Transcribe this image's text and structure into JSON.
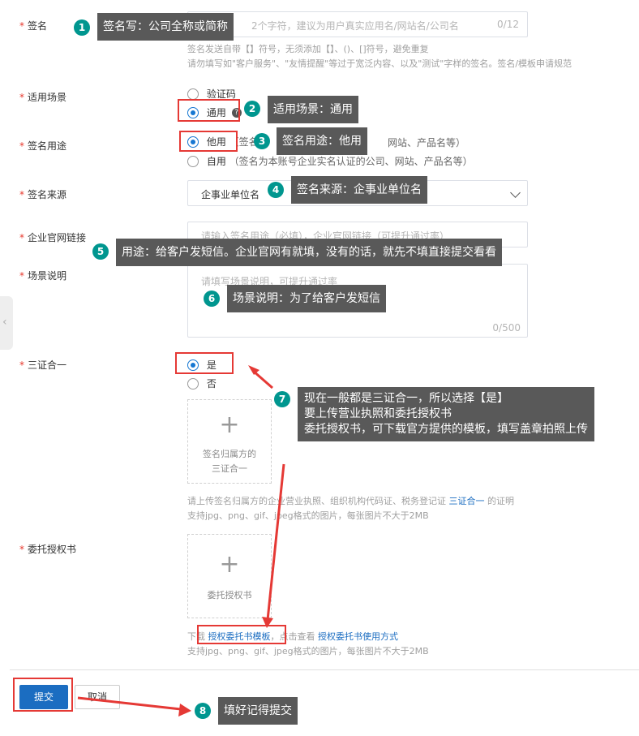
{
  "form": {
    "req": "*",
    "signature": {
      "label": "签名",
      "placeholder": "2个字符，建议为用户真实应用名/网站名/公司名",
      "counter": "0/12",
      "hint1": "签名发送自带【】符号，无须添加【】、()、[]符号，避免重复",
      "hint2": "请勿填写如\"客户服务\"、\"友情提醒\"等过于宽泛内容、以及\"测试\"字样的签名。签名/模板申请规范"
    },
    "scene": {
      "label": "适用场景",
      "opt1": "验证码",
      "opt2": "通用",
      "help": "?"
    },
    "usage": {
      "label": "签名用途",
      "opt1": "他用",
      "opt1_detail": "（签名",
      "opt1_tail": "网站、产品名等）",
      "opt2": "自用",
      "opt2_detail": "（签名为本账号企业实名认证的公司、网站、产品名等）"
    },
    "source": {
      "label": "签名来源",
      "value": "企事业单位名"
    },
    "website": {
      "label": "企业官网链接",
      "placeholder": "请输入签名用途（必填），企业官网链接（可提升通过率）"
    },
    "scene_desc": {
      "label": "场景说明",
      "placeholder": "请填写场景说明，可提升通过率",
      "counter": "0/500"
    },
    "three_in_one": {
      "label": "三证合一",
      "yes": "是",
      "no": "否",
      "upload_line1": "签名归属方的",
      "upload_line2": "三证合一",
      "hint_pre": "请上传签名归属方的企业营业执照、组织机构代码证、税务登记证 ",
      "hint_link": "三证合一",
      "hint_post": " 的证明",
      "hint2": "支持jpg、png、gif、jpeg格式的图片，每张图片不大于2MB"
    },
    "authorization": {
      "label": "委托授权书",
      "upload_text": "委托授权书",
      "dl_pre": "下载 ",
      "dl_link": "授权委托书模板",
      "dl_mid": "，点击查看 ",
      "dl_link2": "授权委托书使用方式",
      "hint2": "支持jpg、png、gif、jpeg格式的图片，每张图片不大于2MB"
    },
    "submit": "提交",
    "cancel": "取消"
  },
  "annotations": {
    "a1": {
      "num": "1",
      "text": "签名写：公司全称或简称"
    },
    "a2": {
      "num": "2",
      "text": "适用场景：通用"
    },
    "a3": {
      "num": "3",
      "text": "签名用途：他用"
    },
    "a4": {
      "num": "4",
      "text": "签名来源：企事业单位名"
    },
    "a5": {
      "num": "5",
      "text": "用途：给客户发短信。企业官网有就填，没有的话，就先不填直接提交看看"
    },
    "a6": {
      "num": "6",
      "text": "场景说明：为了给客户发短信"
    },
    "a7": {
      "num": "7",
      "line1": "现在一般都是三证合一，所以选择【是】",
      "line2": "要上传营业执照和委托授权书",
      "line3": "委托授权书，可下载官方提供的模板，填写盖章拍照上传"
    },
    "a8": {
      "num": "8",
      "text": "填好记得提交"
    }
  },
  "colors": {
    "accent": "#1b6dc1",
    "annotation_bg": "#595959",
    "badge": "#00968f",
    "highlight": "#e53935"
  }
}
